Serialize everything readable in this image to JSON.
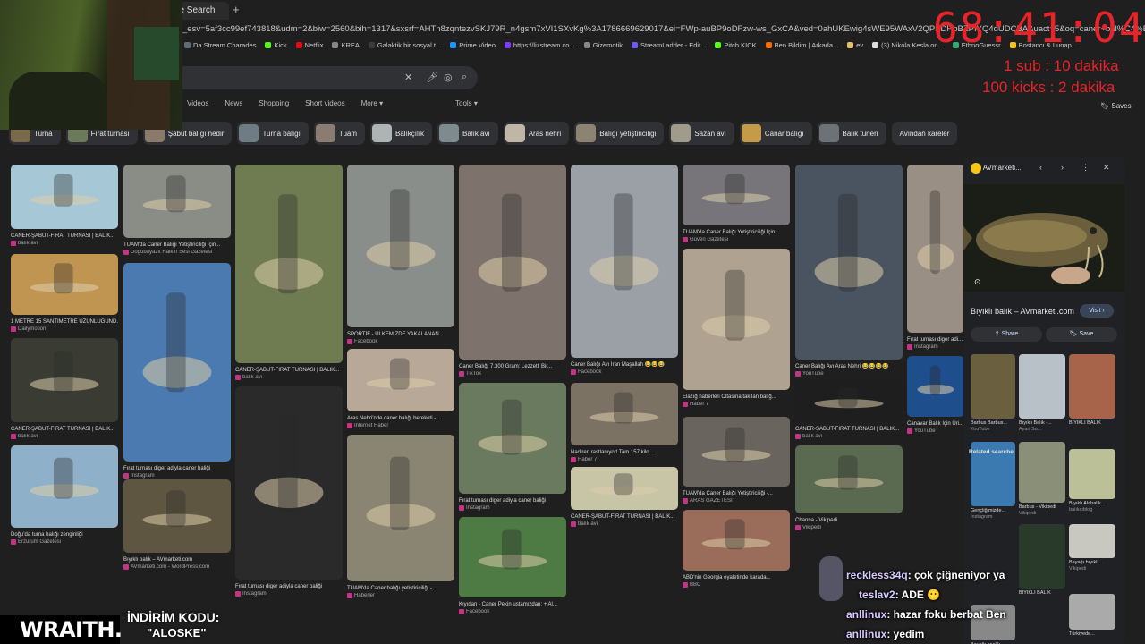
{
  "browser": {
    "tab_title": "ile Search",
    "new_tab": "+",
    "url": "_esv=5af3cc99ef743818&udm=2&biw=2560&bih=1317&sxsrf=AHTn8zqntezvSKJ79R_n4gsm7xVI1SXvKg%3A1786669629017&ei=FWp-auBP9oDFzw-ws_GxCA&ved=0ahUKEwig4sWE95WAxV2QPEDHbBZPIYQ4dUDCBA&uact=5&oq=caner+bal%C4%B1%C4%9F%C4%B1&gs_lp=Egtnd3Mtd2l6",
    "bookmarks": [
      {
        "label": "Da Stream Charades",
        "color": "#5f6b7a"
      },
      {
        "label": "Kick",
        "color": "#53fc18"
      },
      {
        "label": "Netflix",
        "color": "#e50914"
      },
      {
        "label": "KREA",
        "color": "#888888"
      },
      {
        "label": "Galaktik bir sosyal t...",
        "color": "#3a3a3a"
      },
      {
        "label": "Prime Video",
        "color": "#1a98ff"
      },
      {
        "label": "https://lizstream.co...",
        "color": "#7a3cff"
      },
      {
        "label": "Gizemotik",
        "color": "#888888"
      },
      {
        "label": "StreamLadder - Edit...",
        "color": "#6c5ce7"
      },
      {
        "label": "Pitch KICK",
        "color": "#53fc18"
      },
      {
        "label": "Ben Bildim | Arkada...",
        "color": "#ff6a00"
      },
      {
        "label": "ev",
        "color": "#e0c068"
      },
      {
        "label": "(3) Nikola Kesla on...",
        "color": "#dddddd"
      },
      {
        "label": "EthnoGuessr",
        "color": "#3a7"
      },
      {
        "label": "Bostancı & Lunap...",
        "color": "#f5c518"
      }
    ]
  },
  "search": {
    "clear_icon": "close-icon",
    "mic_icon": "mic-icon",
    "lens_icon": "camera-icon",
    "search_icon": "search-icon"
  },
  "nav_tabs": [
    "Videos",
    "News",
    "Shopping",
    "Short videos",
    "More ▾"
  ],
  "tools_label": "Tools ▾",
  "saves_label": "Saves",
  "chips": [
    {
      "label": "Turna",
      "color": "#7a6a4a"
    },
    {
      "label": "Fırat turnası",
      "color": "#6a7a5a"
    },
    {
      "label": "Şabut balığı nedir",
      "color": "#8a7a6a"
    },
    {
      "label": "Turna balığı",
      "color": "#6e7c84"
    },
    {
      "label": "Tuam",
      "color": "#8a7c70"
    },
    {
      "label": "Balıkçılık",
      "color": "#aeb4b4"
    },
    {
      "label": "Balık avı",
      "color": "#7d8a8e"
    },
    {
      "label": "Aras nehri",
      "color": "#bfb6a6"
    },
    {
      "label": "Balığı yetiştiriciliği",
      "color": "#8c8470"
    },
    {
      "label": "Sazan avı",
      "color": "#a09c8c"
    },
    {
      "label": "Canar balığı",
      "color": "#c59b4a"
    },
    {
      "label": "Balık türleri",
      "color": "#6c7276"
    },
    {
      "label": "Avından kareler",
      "color": ""
    }
  ],
  "results": [
    {
      "caption": "CANER-ŞABUT-FIRAT TURNASI | BALIK...",
      "source": "balık avı",
      "color": "#a6c8d6"
    },
    {
      "caption": "TUAM'da Caner Balığı Yetiştiriciliği İçin...",
      "source": "Doğubayazıt Halkın Sesi Gazetesi",
      "color": "#8a8c86"
    },
    {
      "caption": "CANER-ŞABUT-FIRAT TURNASI | BALIK...",
      "source": "balık avı",
      "color": "#6f7c52"
    },
    {
      "caption": "SPORTİF - ÜLKEMİZDE YAKALANAN...",
      "source": "Facebook",
      "color": "#8a8e8a"
    },
    {
      "caption": "Caner Balığı 7.300 Gram: Lezzetli Bir...",
      "source": "TikTok",
      "color": "#7e726c"
    },
    {
      "caption": "Caner Balığı Avı İran Maşallah 😂😂😂",
      "source": "Facebook",
      "color": "#9aa0a6"
    },
    {
      "caption": "TUAM'da Caner Balığı Yetiştiriciliği İçin...",
      "source": "Güven Gazetesi",
      "color": "#77757a"
    },
    {
      "caption": "Caner Balığı Avı Aras Nehri 😂😂😂😂",
      "source": "YouTube",
      "color": "#4a5460"
    },
    {
      "caption": "Fırat turnası diger adi...",
      "source": "Instagram",
      "color": "#9a8f84"
    },
    {
      "caption": "1 METRE 15 SANTİMETRE UZUNLUĞUND...",
      "source": "Dailymotion",
      "color": "#c09552"
    },
    {
      "caption": "CANER-ŞABUT-FIRAT TURNASI | BALIK...",
      "source": "balık avı",
      "color": "#3a3c34"
    },
    {
      "caption": "Doğu'da turna balığı zenginliği",
      "source": "Erzurum Gazetesi",
      "color": "#8eb0c8"
    },
    {
      "caption": "Fırat turnası diger adiyla caner baliği",
      "source": "Instagram",
      "color": "#4a7ab0"
    },
    {
      "caption": "Bıyıklı balık – AVmarketi.com",
      "source": "AVmarketi.com - WordPress.com",
      "color": "#5e5640"
    },
    {
      "caption": "Aras Nehri'nde caner balığı bereketi -...",
      "source": "İnternet Haber",
      "color": "#b8a898"
    },
    {
      "caption": "Fırat turnası diger adiyla caner baliği",
      "source": "Instagram",
      "color": "#2a2a2a"
    },
    {
      "caption": "TUAM'da Caner balığı yetiştiriciliği -...",
      "source": "Haberler",
      "color": "#8a8472"
    },
    {
      "caption": "Fırat turnası diger adiyla caner baliği",
      "source": "Instagram",
      "color": "#6a7a5e"
    },
    {
      "caption": "Kıyıdan - Caner Pekin ustamızdan; + Al...",
      "source": "Facebook",
      "color": "#4e7a44"
    },
    {
      "caption": "Nadiren rastlanıyor! Tam 157 kilo...",
      "source": "Haber 7",
      "color": "#7c7264"
    },
    {
      "caption": "CANER-ŞABUT-FIRAT TURNASI | BALIK...",
      "source": "balık avı",
      "color": "#c8c4a6"
    },
    {
      "caption": "Elazığ haberleri Oltasına takılan balığ...",
      "source": "Haber 7",
      "color": "#b0a290"
    },
    {
      "caption": "TUAM'da Caner Balığı Yetiştiriciliği -...",
      "source": "ARAS GAZETESİ",
      "color": "#6a645e"
    },
    {
      "caption": "ABD'nin Georgia eyaletinde karada...",
      "source": "BBC",
      "color": "#9a6c5a"
    },
    {
      "caption": "CANER-ŞABUT-FIRAT TURNASI | BALIK...",
      "source": "balık avı",
      "color": "#1e1e1e"
    },
    {
      "caption": "Channa - Vikipedi",
      "source": "Vikipedi",
      "color": "#5a6a50"
    },
    {
      "caption": "Canavar Balık İçin Uri...",
      "source": "YouTube",
      "color": "#1f4e8c"
    }
  ],
  "panel": {
    "site": "AVmarketi...",
    "title": "Bıyıklı balık – AVmarketi.com",
    "visit": "Visit ›",
    "share": "Share",
    "save": "Save",
    "related_header": "Related searche",
    "related": [
      "dargın ba",
      "yayın bal",
      "şabut bal"
    ],
    "thumbs": [
      {
        "caption": "Barbus Barbus...",
        "source": "YouTube"
      },
      {
        "caption": "Bıyıklı Balık -...",
        "source": "Ayan Su..."
      },
      {
        "caption": "BIYIKLI BALIK",
        "source": ""
      },
      {
        "caption": "Gençliğimizde...",
        "source": "Instagram"
      },
      {
        "caption": "Barbus - Vikipedi",
        "source": "Vikipedi"
      },
      {
        "caption": "Bıyıklı Alabalık...",
        "source": "balıkcıblog"
      },
      {
        "caption": "BIYIKLI BALIK",
        "source": ""
      },
      {
        "caption": "Bayağı bıyıklı...",
        "source": "Vikipedi"
      },
      {
        "caption": "Bayağı bıyıklı...",
        "source": ""
      },
      {
        "caption": "Türkiyede...",
        "source": ""
      }
    ]
  },
  "overlay": {
    "timer": "68:41:04",
    "line1": "1 sub : 10 dakika",
    "line2": "100 kicks : 2 dakika",
    "streamer_logo": "WRAITH.",
    "promo_line1": "İNDİRİM KODU:",
    "promo_line2": "\"ALOSKE\"",
    "chat": [
      {
        "name": "reckless34q",
        "text": ": çok çiğneniyor ya"
      },
      {
        "name": "teslav2",
        "text": ": ADE 😶"
      },
      {
        "name": "anllinux",
        "text": ": hazar foku berbat Ben"
      },
      {
        "name": "anllinux",
        "text": ": yedim"
      }
    ]
  }
}
